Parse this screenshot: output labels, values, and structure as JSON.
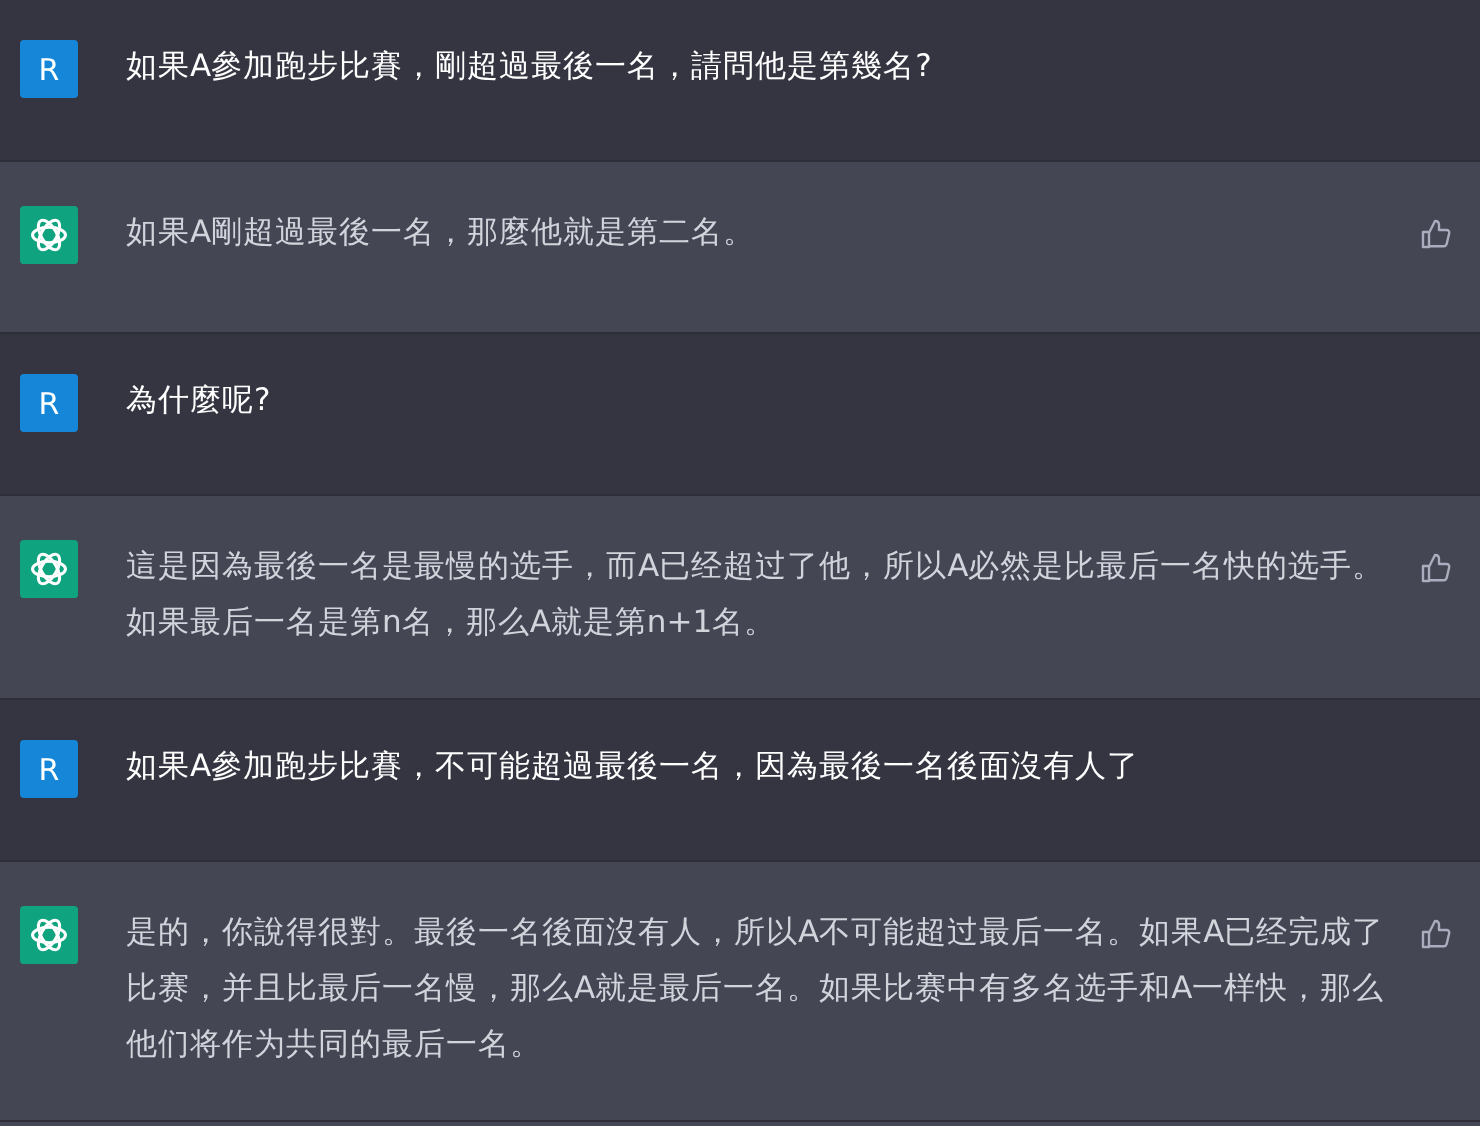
{
  "messages": [
    {
      "kind": "user",
      "avatar": "R",
      "text": "如果A參加跑步比賽，剛超過最後一名，請問他是第幾名?"
    },
    {
      "kind": "assistant",
      "text": "如果A剛超過最後一名，那麼他就是第二名。"
    },
    {
      "kind": "user",
      "avatar": "R",
      "text": "為什麼呢?"
    },
    {
      "kind": "assistant",
      "text": "這是因為最後一名是最慢的选手，而A已经超过了他，所以A必然是比最后一名快的选手。如果最后一名是第n名，那么A就是第n+1名。"
    },
    {
      "kind": "user",
      "avatar": "R",
      "text": "如果A參加跑步比賽，不可能超過最後一名，因為最後一名後面沒有人了"
    },
    {
      "kind": "assistant",
      "text": "是的，你說得很對。最後一名後面沒有人，所以A不可能超过最后一名。如果A已经完成了比赛，并且比最后一名慢，那么A就是最后一名。如果比赛中有多名选手和A一样快，那么他们将作为共同的最后一名。"
    }
  ]
}
